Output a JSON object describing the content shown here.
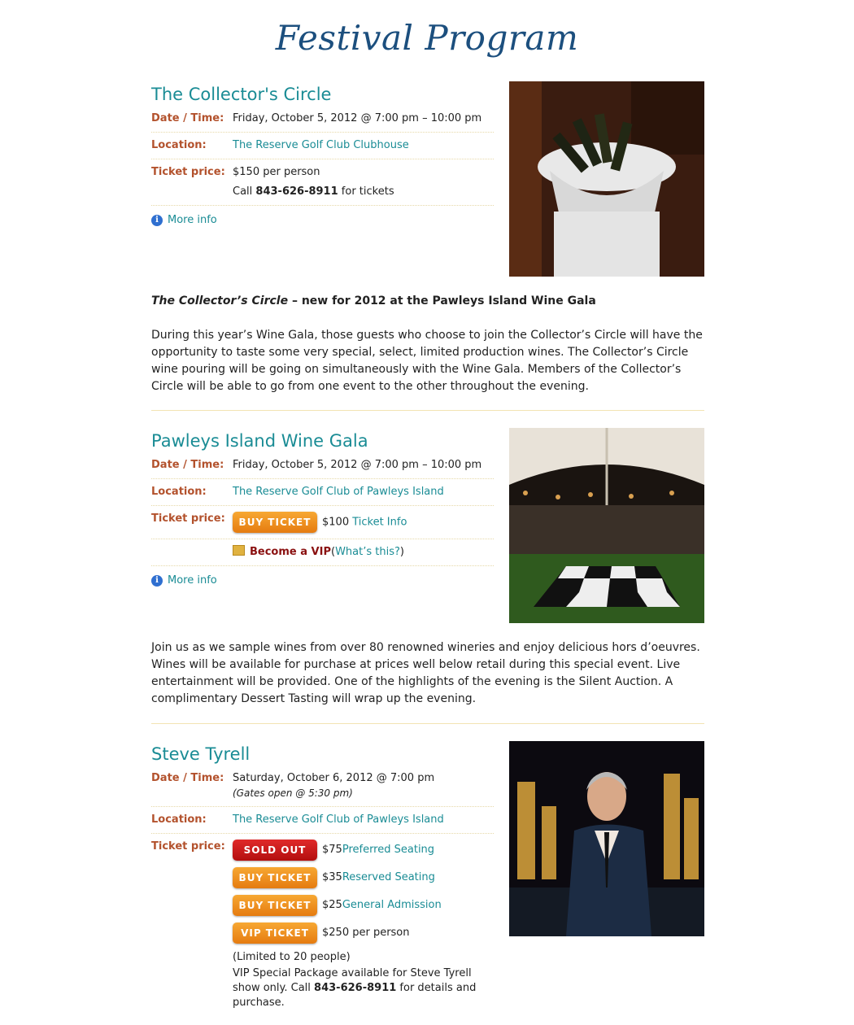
{
  "page": {
    "title": "Festival Program"
  },
  "labels": {
    "date": "Date / Time:",
    "location": "Location:",
    "price": "Ticket price:"
  },
  "events": [
    {
      "title": "The Collector's Circle",
      "date": "Friday, October 5, 2012 @ 7:00 pm – 10:00 pm",
      "location": "The Reserve Golf Club Clubhouse",
      "price_line": "$150 per person",
      "call_pre": "Call ",
      "phone": "843-626-8911",
      "call_post": " for tickets",
      "more_info": "More info",
      "desc_italic": "The Collector’s Circle",
      "desc_bold_rest": " – new for 2012 at the Pawleys Island Wine Gala",
      "description": "During this year’s Wine Gala, those guests who choose to join the Collector’s Circle will have the opportunity to taste some very special, select, limited production wines. The Collector’s Circle wine pouring will be going on simultaneously with the Wine Gala. Members of the Collector’s Circle will be able to go from one event to the other throughout the evening."
    },
    {
      "title": "Pawleys Island Wine Gala",
      "date": "Friday, October 5, 2012 @ 7:00 pm – 10:00 pm",
      "location": "The Reserve Golf Club of Pawleys Island",
      "button": "BUY TICKET",
      "price": "$100 ",
      "price_link": "Ticket Info",
      "vip": "Become a VIP",
      "vip_open": " (",
      "vip_link": "What’s this?",
      "vip_close": ")",
      "more_info": "More info",
      "description": "Join us as we sample wines from over 80 renowned wineries and enjoy delicious hors d’oeuvres. Wines will be available for purchase at prices well below retail during this special event. Live entertainment will be provided. One of the highlights of the evening is the Silent Auction. A complimentary Dessert Tasting will wrap up the evening."
    },
    {
      "title": "Steve Tyrell",
      "date": "Saturday, October 6, 2012 @ 7:00 pm",
      "date_note": "(Gates open @ 5:30 pm)",
      "location": "The Reserve Golf Club of Pawleys Island",
      "tickets": [
        {
          "button": "SOLD OUT",
          "price": "$75 ",
          "link": "Preferred Seating"
        },
        {
          "button": "BUY TICKET",
          "price": "$35 ",
          "link": "Reserved Seating"
        },
        {
          "button": "BUY TICKET",
          "price": "$25 ",
          "link": "General Admission"
        },
        {
          "button": "VIP TICKET",
          "price": "$250 per person",
          "link": ""
        }
      ],
      "limit": "(Limited to 20 people)",
      "package_pre": "VIP Special Package available for Steve Tyrell show only. Call ",
      "phone": "843-626-8911",
      "package_post": " for details and purchase."
    }
  ],
  "colors": {
    "title": "#1c4f7e",
    "heading": "#1a8c95",
    "label": "#b3522d",
    "button": "#f39a22",
    "sold_out": "#cc1a1a"
  }
}
